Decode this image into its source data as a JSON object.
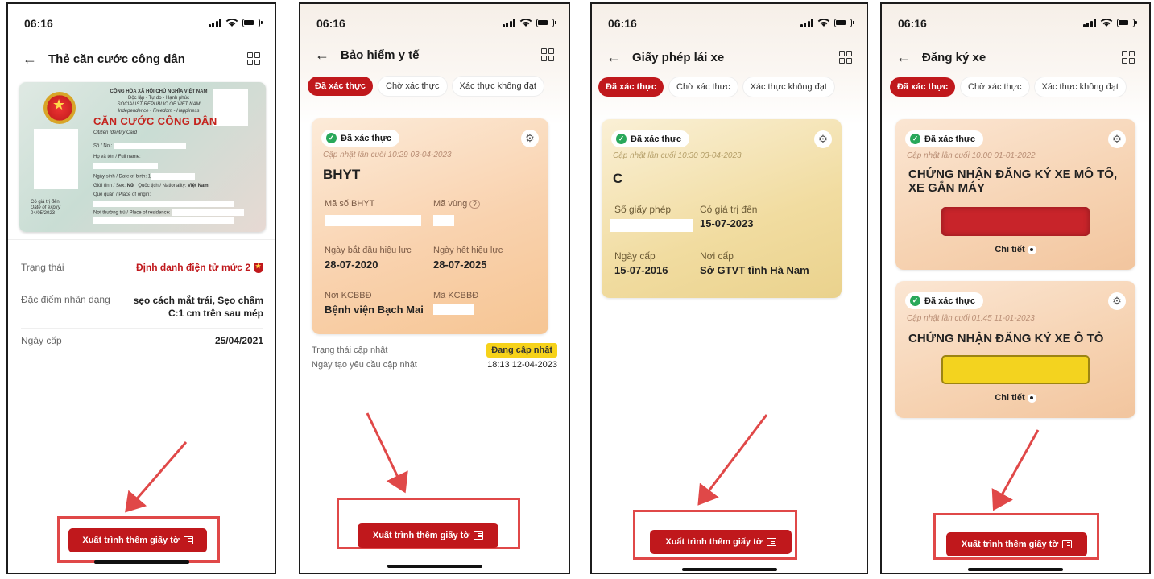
{
  "status_time": "06:16",
  "screens": [
    {
      "title": "Thẻ căn cước công dân",
      "card": {
        "country_line1": "CỘNG HÒA XÃ HỘI CHỦ NGHĨA VIỆT NAM",
        "country_line2": "Độc lập - Tự do - Hạnh phúc",
        "country_line3": "SOCIALIST REPUBLIC OF VIET NAM",
        "country_line4": "Independence - Freedom - Happiness",
        "heading": "CĂN CƯỚC CÔNG DÂN",
        "subheading": "Citizen Identity Card",
        "number_label": "Số / No.:",
        "name_label": "Họ và tên / Full name:",
        "dob_label": "Ngày sinh / Date of birth:",
        "dob_value": "1",
        "sex_label": "Giới tính / Sex:",
        "sex_value": "Nữ",
        "nationality_label": "Quốc tịch / Nationality:",
        "nationality_value": "Việt Nam",
        "origin_label": "Quê quán / Place of origin:",
        "residence_label": "Nơi thường trú / Place of residence:",
        "expiry_label1": "Có giá trị đến:",
        "expiry_label2": "Date of expiry",
        "expiry_value": "04/05/2023"
      },
      "rows": [
        {
          "label": "Trạng thái",
          "value": "Định danh điện tử mức 2"
        },
        {
          "label": "Đặc điểm nhân dạng",
          "value": "sẹo cách mắt trái, Sẹo chấm C:1 cm trên sau mép"
        },
        {
          "label": "Ngày cấp",
          "value": "25/04/2021"
        }
      ],
      "button": "Xuất trình thêm giấy tờ"
    },
    {
      "title": "Bảo hiểm y tế",
      "tabs": [
        "Đã xác thực",
        "Chờ xác thực",
        "Xác thực không đạt"
      ],
      "badge": "Đã xác thực",
      "updated": "Cập nhật lần cuối 10:29 03-04-2023",
      "doc_title": "BHYT",
      "fields": [
        {
          "label": "Mã số BHYT",
          "value": ""
        },
        {
          "label": "Mã vùng",
          "value": ""
        },
        {
          "label": "Ngày bắt đầu hiệu lực",
          "value": "28-07-2020"
        },
        {
          "label": "Ngày hết hiệu lực",
          "value": "28-07-2025"
        },
        {
          "label": "Nơi KCBBĐ",
          "value": "Bệnh viện Bạch Mai"
        },
        {
          "label": "Mã KCBBĐ",
          "value": ""
        }
      ],
      "status_label": "Trạng thái cập nhật",
      "status_value": "Đang cập nhật",
      "request_label": "Ngày tạo yêu cầu cập nhật",
      "request_value": "18:13 12-04-2023",
      "button": "Xuất trình thêm giấy tờ"
    },
    {
      "title": "Giấy phép lái xe",
      "tabs": [
        "Đã xác thực",
        "Chờ xác thực",
        "Xác thực không đạt"
      ],
      "badge": "Đã xác thực",
      "updated": "Cập nhật lần cuối 10:30 03-04-2023",
      "doc_title": "C",
      "fields": [
        {
          "label": "Số giấy phép",
          "value": ""
        },
        {
          "label": "Có giá trị đến",
          "value": "15-07-2023"
        },
        {
          "label": "Ngày cấp",
          "value": "15-07-2016"
        },
        {
          "label": "Nơi cấp",
          "value": "Sở GTVT tỉnh Hà Nam"
        }
      ],
      "button": "Xuất trình thêm giấy tờ"
    },
    {
      "title": "Đăng ký xe",
      "tabs": [
        "Đã xác thực",
        "Chờ xác thực",
        "Xác thực không đạt"
      ],
      "cards": [
        {
          "badge": "Đã xác thực",
          "updated": "Cập nhật lần cuối 10:00 01-01-2022",
          "title": "CHỨNG NHẬN ĐĂNG KÝ XE MÔ TÔ, XE GẮN MÁY",
          "detail": "Chi tiết"
        },
        {
          "badge": "Đã xác thực",
          "updated": "Cập nhật lần cuối 01:45 11-01-2023",
          "title": "CHỨNG NHẬN ĐĂNG KÝ XE Ô TÔ",
          "detail": "Chi tiết"
        }
      ],
      "button": "Xuất trình thêm giấy tờ"
    }
  ],
  "colors": {
    "brand_red": "#c0181c",
    "highlight_box": "#e04848",
    "verified_green": "#29a85a",
    "status_yellow": "#f6d21a"
  }
}
